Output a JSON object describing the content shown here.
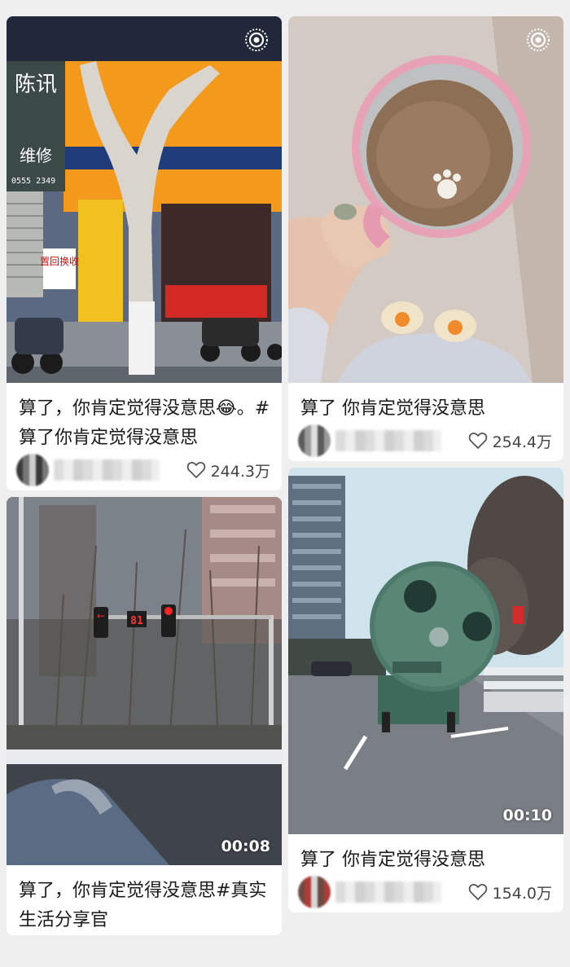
{
  "feed": {
    "cards": [
      {
        "title": "算了，你肯定觉得没意思😂。#算了你肯定觉得没意思",
        "likes": "244.3万"
      },
      {
        "title": "算了 你肯定觉得没意思",
        "likes": "254.4万"
      },
      {
        "title": "算了，你肯定觉得没意思#真实生活分享官",
        "duration": "00:08"
      },
      {
        "title": "算了 你肯定觉得没意思",
        "likes": "154.0万",
        "duration": "00:10"
      }
    ],
    "signs": {
      "shop_vertical": "陈讯",
      "shop_repair": "维修",
      "phone": "0555 2349",
      "recycle": "置回换收",
      "traffic_count": "81"
    }
  },
  "colors": {
    "accent": "#ffffff",
    "text": "#1a1a1a",
    "muted": "#444444"
  }
}
